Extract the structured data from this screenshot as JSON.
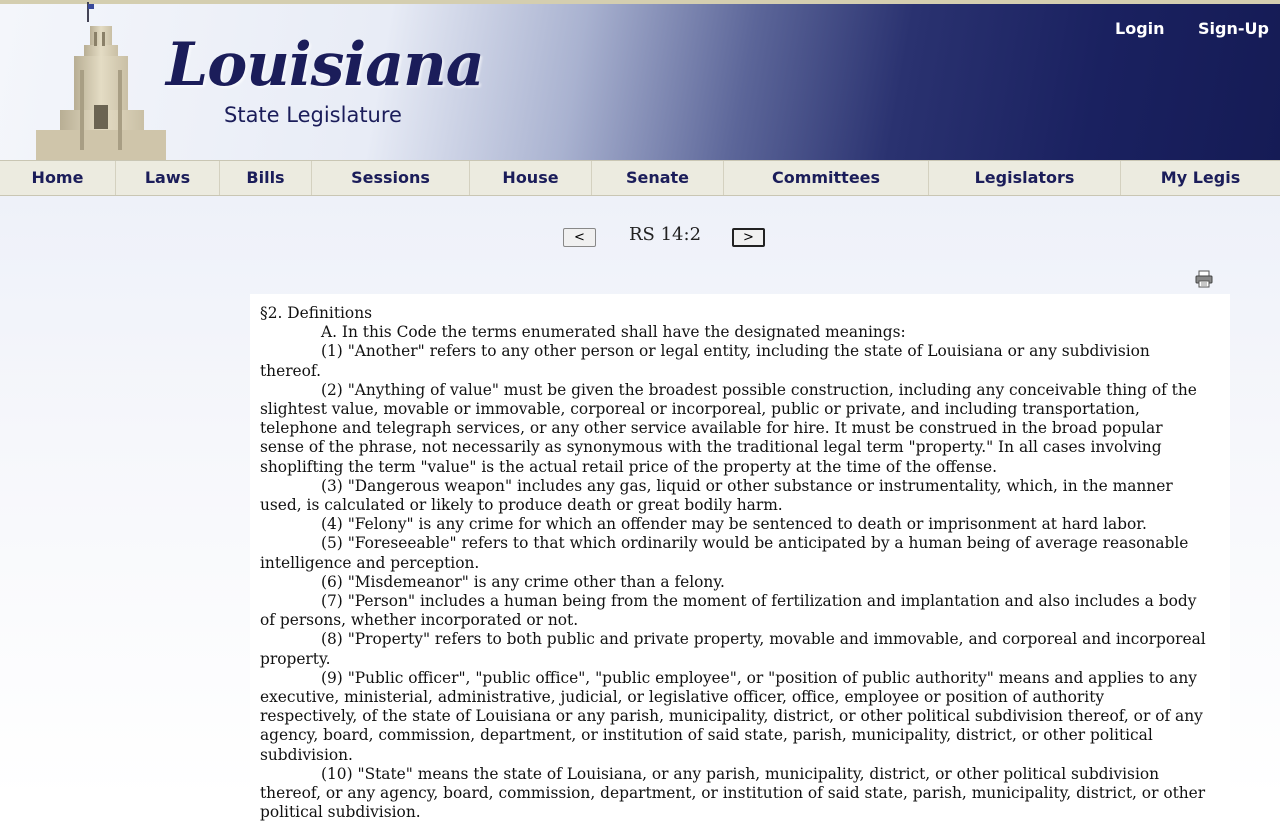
{
  "header": {
    "logo_title": "Louisiana",
    "logo_subtitle": "State Legislature",
    "login_label": "Login",
    "signup_label": "Sign-Up"
  },
  "nav": {
    "items": [
      "Home",
      "Laws",
      "Bills",
      "Sessions",
      "House",
      "Senate",
      "Committees",
      "Legislators",
      "My Legis"
    ]
  },
  "pager": {
    "prev_label": "<",
    "title": "RS 14:2",
    "next_label": ">"
  },
  "icons": {
    "print": "print-icon"
  },
  "document": {
    "heading": "§2. Definitions",
    "paragraphs": [
      "A. In this Code the terms enumerated shall have the designated meanings:",
      "(1) \"Another\" refers to any other person or legal entity, including the state of Louisiana or any subdivision thereof.",
      "(2) \"Anything of value\" must be given the broadest possible construction, including any conceivable thing of the slightest value, movable or immovable, corporeal or incorporeal, public or private, and including transportation, telephone and telegraph services, or any other service available for hire. It must be construed in the broad popular sense of the phrase, not necessarily as synonymous with the traditional legal term \"property.\" In all cases involving shoplifting the term \"value\" is the actual retail price of the property at the time of the offense.",
      "(3) \"Dangerous weapon\" includes any gas, liquid or other substance or instrumentality, which, in the manner used, is calculated or likely to produce death or great bodily harm.",
      "(4) \"Felony\" is any crime for which an offender may be sentenced to death or imprisonment at hard labor.",
      "(5) \"Foreseeable\" refers to that which ordinarily would be anticipated by a human being of average reasonable intelligence and perception.",
      "(6) \"Misdemeanor\" is any crime other than a felony.",
      "(7) \"Person\" includes a human being from the moment of fertilization and implantation and also includes a body of persons, whether incorporated or not.",
      "(8) \"Property\" refers to both public and private property, movable and immovable, and corporeal and incorporeal property.",
      "(9) \"Public officer\", \"public office\", \"public employee\", or \"position of public authority\" means and applies to any executive, ministerial, administrative, judicial, or legislative officer, office, employee or position of authority respectively, of the state of Louisiana or any parish, municipality, district, or other political subdivision thereof, or of any agency, board, commission, department, or institution of said state, parish, municipality, district, or other political subdivision.",
      "(10) \"State\" means the state of Louisiana, or any parish, municipality, district, or other political subdivision thereof, or any agency, board, commission, department, or institution of said state, parish, municipality, district, or other political subdivision."
    ]
  }
}
